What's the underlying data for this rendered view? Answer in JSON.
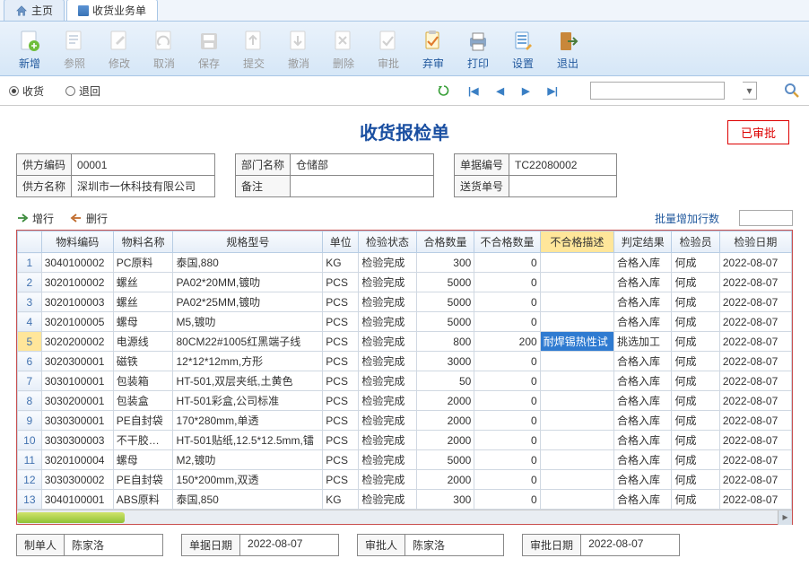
{
  "tabs": {
    "home": "主页",
    "doc": "收货业务单"
  },
  "toolbar": {
    "new": "新增",
    "ref": "参照",
    "edit": "修改",
    "cancel": "取消",
    "save": "保存",
    "submit": "提交",
    "revoke": "撤消",
    "delete": "删除",
    "approve": "审批",
    "reject": "弃审",
    "print": "打印",
    "setting": "设置",
    "exit": "退出"
  },
  "radio": {
    "receive": "收货",
    "return": "退回"
  },
  "title": "收货报检单",
  "stamp": "已审批",
  "header": {
    "supplier_code_lbl": "供方编码",
    "supplier_code": "00001",
    "supplier_name_lbl": "供方名称",
    "supplier_name": "深圳市一休科技有限公司",
    "dept_lbl": "部门名称",
    "dept": "仓储部",
    "remark_lbl": "备注",
    "remark": "",
    "doc_no_lbl": "单据编号",
    "doc_no": "TC22080002",
    "deliver_no_lbl": "送货单号",
    "deliver_no": ""
  },
  "gridbar": {
    "add": "增行",
    "del": "删行",
    "batch_lbl": "批量增加行数"
  },
  "cols": {
    "mat_code": "物料编码",
    "mat_name": "物料名称",
    "spec": "规格型号",
    "unit": "单位",
    "insp_status": "检验状态",
    "ok_qty": "合格数量",
    "ng_qty": "不合格数量",
    "ng_desc": "不合格描述",
    "judge": "判定结果",
    "inspector": "检验员",
    "insp_date": "检验日期"
  },
  "rows": [
    {
      "n": "1",
      "code": "3040100002",
      "name": "PC原料",
      "spec": "泰国,880",
      "unit": "KG",
      "st": "检验完成",
      "ok": "300",
      "ng": "0",
      "desc": "",
      "jg": "合格入库",
      "ins": "何成",
      "dt": "2022-08-07"
    },
    {
      "n": "2",
      "code": "3020100002",
      "name": "螺丝",
      "spec": "PA02*20MM,镀叻",
      "unit": "PCS",
      "st": "检验完成",
      "ok": "5000",
      "ng": "0",
      "desc": "",
      "jg": "合格入库",
      "ins": "何成",
      "dt": "2022-08-07"
    },
    {
      "n": "3",
      "code": "3020100003",
      "name": "螺丝",
      "spec": "PA02*25MM,镀叻",
      "unit": "PCS",
      "st": "检验完成",
      "ok": "5000",
      "ng": "0",
      "desc": "",
      "jg": "合格入库",
      "ins": "何成",
      "dt": "2022-08-07"
    },
    {
      "n": "4",
      "code": "3020100005",
      "name": "螺母",
      "spec": "M5,镀叻",
      "unit": "PCS",
      "st": "检验完成",
      "ok": "5000",
      "ng": "0",
      "desc": "",
      "jg": "合格入库",
      "ins": "何成",
      "dt": "2022-08-07"
    },
    {
      "n": "5",
      "code": "3020200002",
      "name": "电源线",
      "spec": "80CM22#1005红黑端子线",
      "unit": "PCS",
      "st": "检验完成",
      "ok": "800",
      "ng": "200",
      "desc": "耐焊锡热性试",
      "jg": "挑选加工",
      "ins": "何成",
      "dt": "2022-08-07"
    },
    {
      "n": "6",
      "code": "3020300001",
      "name": "磁铁",
      "spec": "12*12*12mm,方形",
      "unit": "PCS",
      "st": "检验完成",
      "ok": "3000",
      "ng": "0",
      "desc": "",
      "jg": "合格入库",
      "ins": "何成",
      "dt": "2022-08-07"
    },
    {
      "n": "7",
      "code": "3030100001",
      "name": "包装箱",
      "spec": "HT-501,双层夹纸,土黄色",
      "unit": "PCS",
      "st": "检验完成",
      "ok": "50",
      "ng": "0",
      "desc": "",
      "jg": "合格入库",
      "ins": "何成",
      "dt": "2022-08-07"
    },
    {
      "n": "8",
      "code": "3030200001",
      "name": "包装盒",
      "spec": "HT-501彩盒,公司标准",
      "unit": "PCS",
      "st": "检验完成",
      "ok": "2000",
      "ng": "0",
      "desc": "",
      "jg": "合格入库",
      "ins": "何成",
      "dt": "2022-08-07"
    },
    {
      "n": "9",
      "code": "3030300001",
      "name": "PE自封袋",
      "spec": "170*280mm,单透",
      "unit": "PCS",
      "st": "检验完成",
      "ok": "2000",
      "ng": "0",
      "desc": "",
      "jg": "合格入库",
      "ins": "何成",
      "dt": "2022-08-07"
    },
    {
      "n": "10",
      "code": "3030300003",
      "name": "不干胶贴纸",
      "spec": "HT-501贴纸,12.5*12.5mm,镭",
      "unit": "PCS",
      "st": "检验完成",
      "ok": "2000",
      "ng": "0",
      "desc": "",
      "jg": "合格入库",
      "ins": "何成",
      "dt": "2022-08-07"
    },
    {
      "n": "11",
      "code": "3020100004",
      "name": "螺母",
      "spec": "M2,镀叻",
      "unit": "PCS",
      "st": "检验完成",
      "ok": "5000",
      "ng": "0",
      "desc": "",
      "jg": "合格入库",
      "ins": "何成",
      "dt": "2022-08-07"
    },
    {
      "n": "12",
      "code": "3030300002",
      "name": "PE自封袋",
      "spec": "150*200mm,双透",
      "unit": "PCS",
      "st": "检验完成",
      "ok": "2000",
      "ng": "0",
      "desc": "",
      "jg": "合格入库",
      "ins": "何成",
      "dt": "2022-08-07"
    },
    {
      "n": "13",
      "code": "3040100001",
      "name": "ABS原料",
      "spec": "泰国,850",
      "unit": "KG",
      "st": "检验完成",
      "ok": "300",
      "ng": "0",
      "desc": "",
      "jg": "合格入库",
      "ins": "何成",
      "dt": "2022-08-07"
    }
  ],
  "footer": {
    "maker_lbl": "制单人",
    "maker": "陈家洛",
    "doc_date_lbl": "单据日期",
    "doc_date": "2022-08-07",
    "approver_lbl": "审批人",
    "approver": "陈家洛",
    "approve_date_lbl": "审批日期",
    "approve_date": "2022-08-07"
  }
}
